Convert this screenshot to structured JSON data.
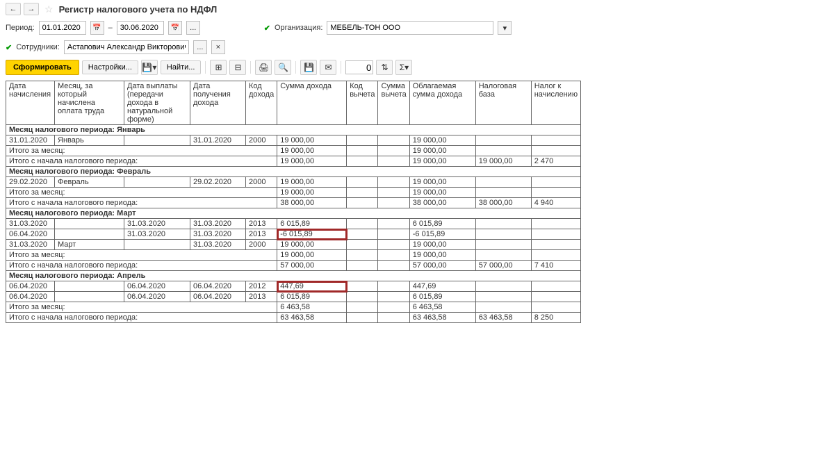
{
  "header": {
    "title": "Регистр налогового учета по НДФЛ"
  },
  "period": {
    "label": "Период:",
    "from": "01.01.2020",
    "to": "30.06.2020",
    "dash": "–"
  },
  "org": {
    "label": "Организация:",
    "value": "МЕБЕЛЬ-ТОН ООО"
  },
  "employee": {
    "label": "Сотрудники:",
    "value": "Астапович Александр Викторович"
  },
  "toolbar": {
    "generate": "Сформировать",
    "settings": "Настройки...",
    "find": "Найти...",
    "zero": "0"
  },
  "columns": {
    "c1": "Дата начисления",
    "c2": "Месяц, за который начислена оплата труда",
    "c3": "Дата выплаты (передачи дохода в натуральной форме)",
    "c4": "Дата получения дохода",
    "c5": "Код дохода",
    "c6": "Сумма дохода",
    "c7": "Код вычета",
    "c8": "Сумма вычета",
    "c9": "Облагаемая сумма дохода",
    "c10": "Налоговая база",
    "c11": "Налог к начислению"
  },
  "groups": [
    {
      "title": "Месяц налогового периода: Январь",
      "rows": [
        {
          "c1": "31.01.2020",
          "c2": "Январь",
          "c3": "",
          "c4": "31.01.2020",
          "c5": "2000",
          "c6": "19 000,00",
          "c7": "",
          "c8": "",
          "c9": "19 000,00",
          "c10": "",
          "c11": ""
        }
      ],
      "month_total": {
        "label": "Итого за месяц:",
        "c6": "19 000,00",
        "c9": "19 000,00"
      },
      "period_total": {
        "label": "Итого с начала налогового периода:",
        "c6": "19 000,00",
        "c9": "19 000,00",
        "c10": "19 000,00",
        "c11": "2 470"
      }
    },
    {
      "title": "Месяц налогового периода: Февраль",
      "rows": [
        {
          "c1": "29.02.2020",
          "c2": "Февраль",
          "c3": "",
          "c4": "29.02.2020",
          "c5": "2000",
          "c6": "19 000,00",
          "c7": "",
          "c8": "",
          "c9": "19 000,00",
          "c10": "",
          "c11": ""
        }
      ],
      "month_total": {
        "label": "Итого за месяц:",
        "c6": "19 000,00",
        "c9": "19 000,00"
      },
      "period_total": {
        "label": "Итого с начала налогового периода:",
        "c6": "38 000,00",
        "c9": "38 000,00",
        "c10": "38 000,00",
        "c11": "4 940"
      }
    },
    {
      "title": "Месяц налогового периода: Март",
      "rows": [
        {
          "c1": "31.03.2020",
          "c2": "",
          "c3": "31.03.2020",
          "c4": "31.03.2020",
          "c5": "2013",
          "c6": "6 015,89",
          "c7": "",
          "c8": "",
          "c9": "6 015,89",
          "c10": "",
          "c11": ""
        },
        {
          "c1": "06.04.2020",
          "c2": "",
          "c3": "31.03.2020",
          "c4": "31.03.2020",
          "c5": "2013",
          "c6": "-6 015,89",
          "c7": "",
          "c8": "",
          "c9": "-6 015,89",
          "c10": "",
          "c11": "",
          "hl": true
        },
        {
          "c1": "31.03.2020",
          "c2": "Март",
          "c3": "",
          "c4": "31.03.2020",
          "c5": "2000",
          "c6": "19 000,00",
          "c7": "",
          "c8": "",
          "c9": "19 000,00",
          "c10": "",
          "c11": ""
        }
      ],
      "month_total": {
        "label": "Итого за месяц:",
        "c6": "19 000,00",
        "c9": "19 000,00"
      },
      "period_total": {
        "label": "Итого с начала налогового периода:",
        "c6": "57 000,00",
        "c9": "57 000,00",
        "c10": "57 000,00",
        "c11": "7 410"
      }
    },
    {
      "title": "Месяц налогового периода: Апрель",
      "rows": [
        {
          "c1": "06.04.2020",
          "c2": "",
          "c3": "06.04.2020",
          "c4": "06.04.2020",
          "c5": "2012",
          "c6": "447,69",
          "c7": "",
          "c8": "",
          "c9": "447,69",
          "c10": "",
          "c11": "",
          "hl": true
        },
        {
          "c1": "06.04.2020",
          "c2": "",
          "c3": "06.04.2020",
          "c4": "06.04.2020",
          "c5": "2013",
          "c6": "6 015,89",
          "c7": "",
          "c8": "",
          "c9": "6 015,89",
          "c10": "",
          "c11": ""
        }
      ],
      "month_total": {
        "label": "Итого за месяц:",
        "c6": "6 463,58",
        "c9": "6 463,58"
      },
      "period_total": {
        "label": "Итого с начала налогового периода:",
        "c6": "63 463,58",
        "c9": "63 463,58",
        "c10": "63 463,58",
        "c11": "8 250"
      }
    }
  ]
}
